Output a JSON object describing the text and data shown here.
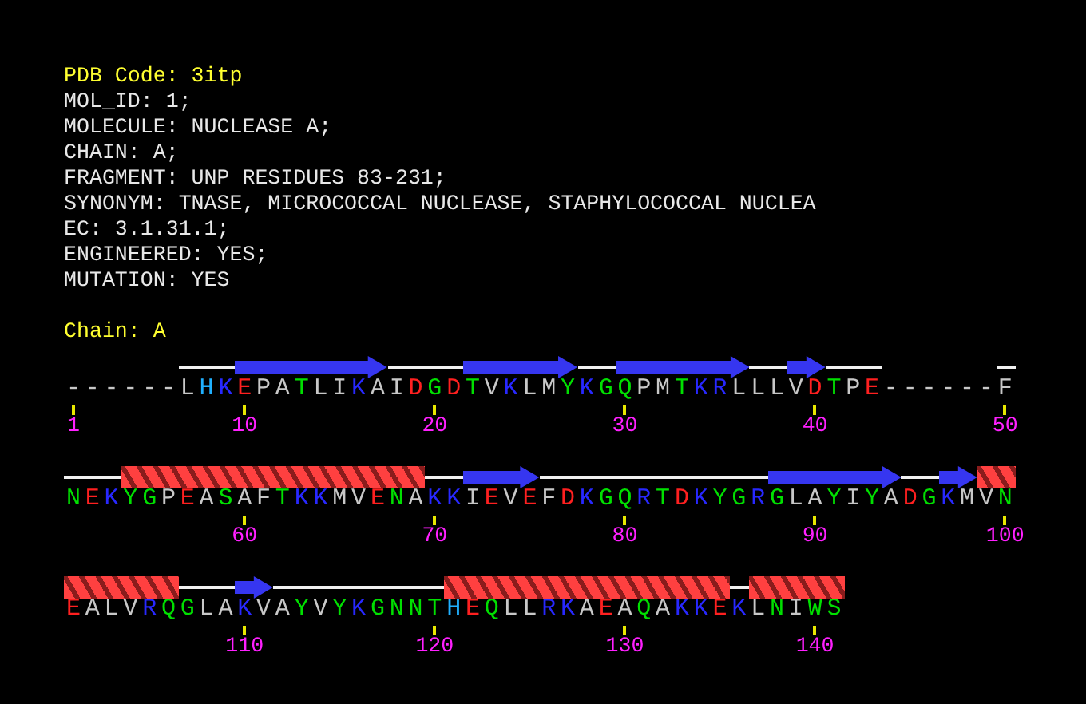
{
  "header": [
    {
      "text": "PDB Code: 3itp",
      "kind": "title"
    },
    {
      "text": "MOL_ID: 1;",
      "kind": "field"
    },
    {
      "text": "MOLECULE: NUCLEASE A;",
      "kind": "field"
    },
    {
      "text": "CHAIN: A;",
      "kind": "field"
    },
    {
      "text": "FRAGMENT: UNP RESIDUES 83-231;",
      "kind": "field"
    },
    {
      "text": "SYNONYM: TNASE, MICROCOCCAL NUCLEASE, STAPHYLOCOCCAL NUCLEA",
      "kind": "field"
    },
    {
      "text": "EC: 3.1.31.1;",
      "kind": "field"
    },
    {
      "text": "ENGINEERED: YES;",
      "kind": "field"
    },
    {
      "text": "MUTATION: YES",
      "kind": "field"
    }
  ],
  "chain_label": "Chain: A",
  "lines": [
    {
      "residues": [
        {
          "aa": "-",
          "color": "#c8c8c8",
          "kind": "gap",
          "number": "1"
        },
        {
          "aa": "-",
          "color": "#c8c8c8",
          "kind": "gap"
        },
        {
          "aa": "-",
          "color": "#c8c8c8",
          "kind": "gap"
        },
        {
          "aa": "-",
          "color": "#c8c8c8",
          "kind": "gap"
        },
        {
          "aa": "-",
          "color": "#c8c8c8",
          "kind": "gap"
        },
        {
          "aa": "-",
          "color": "#c8c8c8",
          "kind": "gap"
        },
        {
          "aa": "L",
          "color": "#c8c8c8",
          "kind": "coil"
        },
        {
          "aa": "H",
          "color": "#20b0ff",
          "kind": "coil"
        },
        {
          "aa": "K",
          "color": "#2828ff",
          "kind": "coil"
        },
        {
          "aa": "E",
          "color": "#ff2020",
          "kind": "strand",
          "number": "10"
        },
        {
          "aa": "P",
          "color": "#c8c8c8",
          "kind": "strand"
        },
        {
          "aa": "A",
          "color": "#c8c8c8",
          "kind": "strand"
        },
        {
          "aa": "T",
          "color": "#00e000",
          "kind": "strand"
        },
        {
          "aa": "L",
          "color": "#c8c8c8",
          "kind": "strand"
        },
        {
          "aa": "I",
          "color": "#c8c8c8",
          "kind": "strand"
        },
        {
          "aa": "K",
          "color": "#2828ff",
          "kind": "strand"
        },
        {
          "aa": "A",
          "color": "#c8c8c8",
          "kind": "strand"
        },
        {
          "aa": "I",
          "color": "#c8c8c8",
          "kind": "coil"
        },
        {
          "aa": "D",
          "color": "#ff2020",
          "kind": "coil"
        },
        {
          "aa": "G",
          "color": "#00e000",
          "kind": "coil",
          "number": "20"
        },
        {
          "aa": "D",
          "color": "#ff2020",
          "kind": "coil"
        },
        {
          "aa": "T",
          "color": "#00e000",
          "kind": "strand"
        },
        {
          "aa": "V",
          "color": "#c8c8c8",
          "kind": "strand"
        },
        {
          "aa": "K",
          "color": "#2828ff",
          "kind": "strand"
        },
        {
          "aa": "L",
          "color": "#c8c8c8",
          "kind": "strand"
        },
        {
          "aa": "M",
          "color": "#c8c8c8",
          "kind": "strand"
        },
        {
          "aa": "Y",
          "color": "#00e000",
          "kind": "strand"
        },
        {
          "aa": "K",
          "color": "#2828ff",
          "kind": "coil"
        },
        {
          "aa": "G",
          "color": "#00e000",
          "kind": "coil"
        },
        {
          "aa": "Q",
          "color": "#00e000",
          "kind": "strand",
          "number": "30"
        },
        {
          "aa": "P",
          "color": "#c8c8c8",
          "kind": "strand"
        },
        {
          "aa": "M",
          "color": "#c8c8c8",
          "kind": "strand"
        },
        {
          "aa": "T",
          "color": "#00e000",
          "kind": "strand"
        },
        {
          "aa": "K",
          "color": "#2828ff",
          "kind": "strand"
        },
        {
          "aa": "R",
          "color": "#2828ff",
          "kind": "strand"
        },
        {
          "aa": "L",
          "color": "#c8c8c8",
          "kind": "strand"
        },
        {
          "aa": "L",
          "color": "#c8c8c8",
          "kind": "coil"
        },
        {
          "aa": "L",
          "color": "#c8c8c8",
          "kind": "coil"
        },
        {
          "aa": "V",
          "color": "#c8c8c8",
          "kind": "strand"
        },
        {
          "aa": "D",
          "color": "#ff2020",
          "kind": "strand",
          "number": "40"
        },
        {
          "aa": "T",
          "color": "#00e000",
          "kind": "coil"
        },
        {
          "aa": "P",
          "color": "#c8c8c8",
          "kind": "coil"
        },
        {
          "aa": "E",
          "color": "#ff2020",
          "kind": "coil"
        },
        {
          "aa": "-",
          "color": "#c8c8c8",
          "kind": "gap"
        },
        {
          "aa": "-",
          "color": "#c8c8c8",
          "kind": "gap"
        },
        {
          "aa": "-",
          "color": "#c8c8c8",
          "kind": "gap"
        },
        {
          "aa": "-",
          "color": "#c8c8c8",
          "kind": "gap"
        },
        {
          "aa": "-",
          "color": "#c8c8c8",
          "kind": "gap"
        },
        {
          "aa": "-",
          "color": "#c8c8c8",
          "kind": "gap"
        },
        {
          "aa": "F",
          "color": "#c8c8c8",
          "kind": "coil",
          "number": "50"
        }
      ]
    },
    {
      "residues": [
        {
          "aa": "N",
          "color": "#00e000",
          "kind": "coil"
        },
        {
          "aa": "E",
          "color": "#ff2020",
          "kind": "coil"
        },
        {
          "aa": "K",
          "color": "#2828ff",
          "kind": "coil"
        },
        {
          "aa": "Y",
          "color": "#00e000",
          "kind": "helix"
        },
        {
          "aa": "G",
          "color": "#00e000",
          "kind": "helix"
        },
        {
          "aa": "P",
          "color": "#c8c8c8",
          "kind": "helix"
        },
        {
          "aa": "E",
          "color": "#ff2020",
          "kind": "helix"
        },
        {
          "aa": "A",
          "color": "#c8c8c8",
          "kind": "helix"
        },
        {
          "aa": "S",
          "color": "#00e000",
          "kind": "helix"
        },
        {
          "aa": "A",
          "color": "#c8c8c8",
          "kind": "helix",
          "number": "60"
        },
        {
          "aa": "F",
          "color": "#c8c8c8",
          "kind": "helix"
        },
        {
          "aa": "T",
          "color": "#00e000",
          "kind": "helix"
        },
        {
          "aa": "K",
          "color": "#2828ff",
          "kind": "helix"
        },
        {
          "aa": "K",
          "color": "#2828ff",
          "kind": "helix"
        },
        {
          "aa": "M",
          "color": "#c8c8c8",
          "kind": "helix"
        },
        {
          "aa": "V",
          "color": "#c8c8c8",
          "kind": "helix"
        },
        {
          "aa": "E",
          "color": "#ff2020",
          "kind": "helix"
        },
        {
          "aa": "N",
          "color": "#00e000",
          "kind": "helix"
        },
        {
          "aa": "A",
          "color": "#c8c8c8",
          "kind": "helix"
        },
        {
          "aa": "K",
          "color": "#2828ff",
          "kind": "coil",
          "number": "70"
        },
        {
          "aa": "K",
          "color": "#2828ff",
          "kind": "coil"
        },
        {
          "aa": "I",
          "color": "#c8c8c8",
          "kind": "strand"
        },
        {
          "aa": "E",
          "color": "#ff2020",
          "kind": "strand"
        },
        {
          "aa": "V",
          "color": "#c8c8c8",
          "kind": "strand"
        },
        {
          "aa": "E",
          "color": "#ff2020",
          "kind": "strand"
        },
        {
          "aa": "F",
          "color": "#c8c8c8",
          "kind": "coil"
        },
        {
          "aa": "D",
          "color": "#ff2020",
          "kind": "coil"
        },
        {
          "aa": "K",
          "color": "#2828ff",
          "kind": "coil"
        },
        {
          "aa": "G",
          "color": "#00e000",
          "kind": "coil"
        },
        {
          "aa": "Q",
          "color": "#00e000",
          "kind": "coil",
          "number": "80"
        },
        {
          "aa": "R",
          "color": "#2828ff",
          "kind": "coil"
        },
        {
          "aa": "T",
          "color": "#00e000",
          "kind": "coil"
        },
        {
          "aa": "D",
          "color": "#ff2020",
          "kind": "coil"
        },
        {
          "aa": "K",
          "color": "#2828ff",
          "kind": "coil"
        },
        {
          "aa": "Y",
          "color": "#00e000",
          "kind": "coil"
        },
        {
          "aa": "G",
          "color": "#00e000",
          "kind": "coil"
        },
        {
          "aa": "R",
          "color": "#2828ff",
          "kind": "coil"
        },
        {
          "aa": "G",
          "color": "#00e000",
          "kind": "strand"
        },
        {
          "aa": "L",
          "color": "#c8c8c8",
          "kind": "strand"
        },
        {
          "aa": "A",
          "color": "#c8c8c8",
          "kind": "strand",
          "number": "90"
        },
        {
          "aa": "Y",
          "color": "#00e000",
          "kind": "strand"
        },
        {
          "aa": "I",
          "color": "#c8c8c8",
          "kind": "strand"
        },
        {
          "aa": "Y",
          "color": "#00e000",
          "kind": "strand"
        },
        {
          "aa": "A",
          "color": "#c8c8c8",
          "kind": "strand"
        },
        {
          "aa": "D",
          "color": "#ff2020",
          "kind": "coil"
        },
        {
          "aa": "G",
          "color": "#00e000",
          "kind": "coil"
        },
        {
          "aa": "K",
          "color": "#2828ff",
          "kind": "strand"
        },
        {
          "aa": "M",
          "color": "#c8c8c8",
          "kind": "strand"
        },
        {
          "aa": "V",
          "color": "#c8c8c8",
          "kind": "helix"
        },
        {
          "aa": "N",
          "color": "#00e000",
          "kind": "helix",
          "number": "100"
        }
      ]
    },
    {
      "residues": [
        {
          "aa": "E",
          "color": "#ff2020",
          "kind": "helix"
        },
        {
          "aa": "A",
          "color": "#c8c8c8",
          "kind": "helix"
        },
        {
          "aa": "L",
          "color": "#c8c8c8",
          "kind": "helix"
        },
        {
          "aa": "V",
          "color": "#c8c8c8",
          "kind": "helix"
        },
        {
          "aa": "R",
          "color": "#2828ff",
          "kind": "helix"
        },
        {
          "aa": "Q",
          "color": "#00e000",
          "kind": "helix"
        },
        {
          "aa": "G",
          "color": "#00e000",
          "kind": "coil"
        },
        {
          "aa": "L",
          "color": "#c8c8c8",
          "kind": "coil"
        },
        {
          "aa": "A",
          "color": "#c8c8c8",
          "kind": "coil"
        },
        {
          "aa": "K",
          "color": "#2828ff",
          "kind": "strand",
          "number": "110"
        },
        {
          "aa": "V",
          "color": "#c8c8c8",
          "kind": "strand"
        },
        {
          "aa": "A",
          "color": "#c8c8c8",
          "kind": "coil"
        },
        {
          "aa": "Y",
          "color": "#00e000",
          "kind": "coil"
        },
        {
          "aa": "V",
          "color": "#c8c8c8",
          "kind": "coil"
        },
        {
          "aa": "Y",
          "color": "#00e000",
          "kind": "coil"
        },
        {
          "aa": "K",
          "color": "#2828ff",
          "kind": "coil"
        },
        {
          "aa": "G",
          "color": "#00e000",
          "kind": "coil"
        },
        {
          "aa": "N",
          "color": "#00e000",
          "kind": "coil"
        },
        {
          "aa": "N",
          "color": "#00e000",
          "kind": "coil"
        },
        {
          "aa": "T",
          "color": "#00e000",
          "kind": "coil",
          "number": "120"
        },
        {
          "aa": "H",
          "color": "#20b0ff",
          "kind": "helix"
        },
        {
          "aa": "E",
          "color": "#ff2020",
          "kind": "helix"
        },
        {
          "aa": "Q",
          "color": "#00e000",
          "kind": "helix"
        },
        {
          "aa": "L",
          "color": "#c8c8c8",
          "kind": "helix"
        },
        {
          "aa": "L",
          "color": "#c8c8c8",
          "kind": "helix"
        },
        {
          "aa": "R",
          "color": "#2828ff",
          "kind": "helix"
        },
        {
          "aa": "K",
          "color": "#2828ff",
          "kind": "helix"
        },
        {
          "aa": "A",
          "color": "#c8c8c8",
          "kind": "helix"
        },
        {
          "aa": "E",
          "color": "#ff2020",
          "kind": "helix"
        },
        {
          "aa": "A",
          "color": "#c8c8c8",
          "kind": "helix",
          "number": "130"
        },
        {
          "aa": "Q",
          "color": "#00e000",
          "kind": "helix"
        },
        {
          "aa": "A",
          "color": "#c8c8c8",
          "kind": "helix"
        },
        {
          "aa": "K",
          "color": "#2828ff",
          "kind": "helix"
        },
        {
          "aa": "K",
          "color": "#2828ff",
          "kind": "helix"
        },
        {
          "aa": "E",
          "color": "#ff2020",
          "kind": "helix"
        },
        {
          "aa": "K",
          "color": "#2828ff",
          "kind": "coil"
        },
        {
          "aa": "L",
          "color": "#c8c8c8",
          "kind": "helix"
        },
        {
          "aa": "N",
          "color": "#00e000",
          "kind": "helix"
        },
        {
          "aa": "I",
          "color": "#c8c8c8",
          "kind": "helix"
        },
        {
          "aa": "W",
          "color": "#00e000",
          "kind": "helix",
          "number": "140"
        },
        {
          "aa": "S",
          "color": "#00e000",
          "kind": "helix"
        }
      ]
    }
  ]
}
